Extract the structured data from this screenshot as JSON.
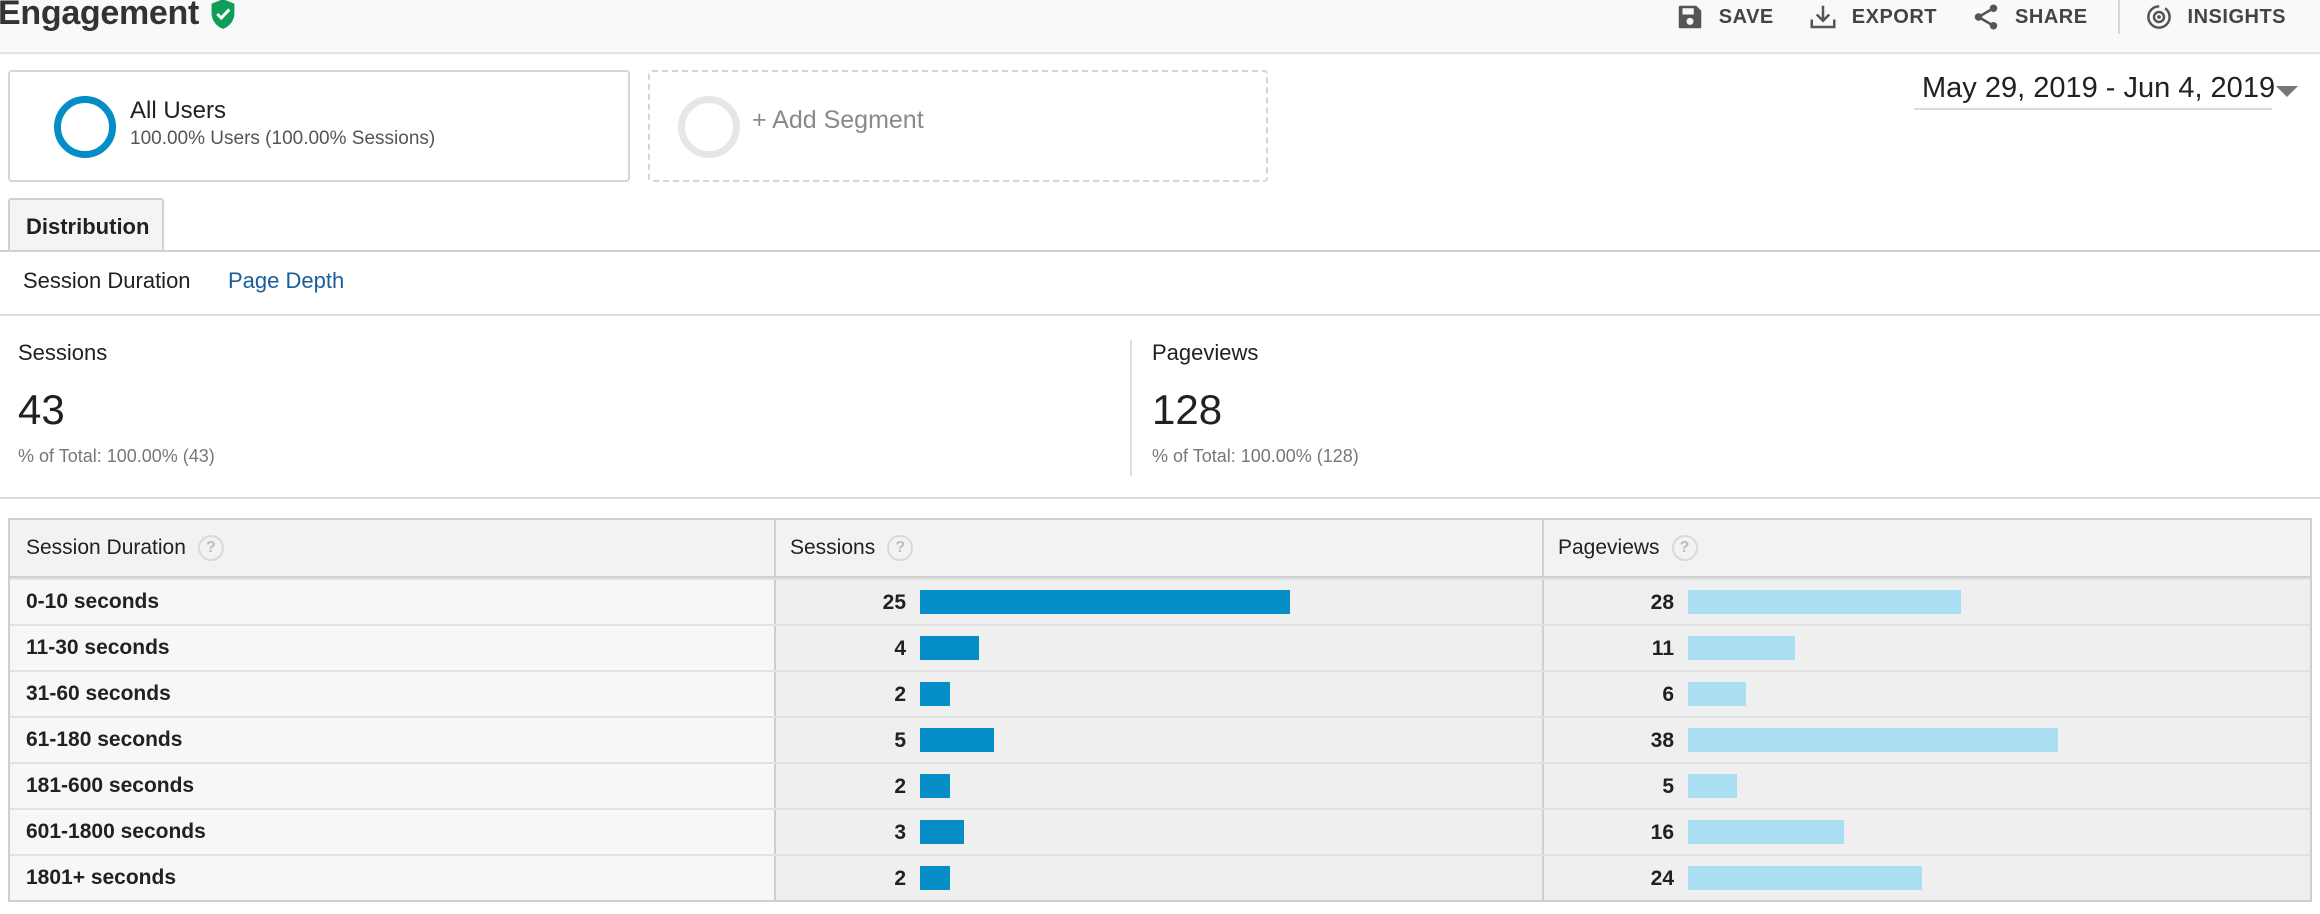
{
  "header": {
    "title": "Engagement",
    "actions": [
      {
        "icon": "save-icon",
        "label": "SAVE"
      },
      {
        "icon": "export-icon",
        "label": "EXPORT"
      },
      {
        "icon": "share-icon",
        "label": "SHARE"
      },
      {
        "icon": "insights-icon",
        "label": "INSIGHTS"
      }
    ]
  },
  "segments": {
    "all": {
      "name": "All Users",
      "detail": "100.00% Users (100.00% Sessions)"
    },
    "add_label": "+ Add Segment"
  },
  "date_range": "May 29, 2019 - Jun 4, 2019",
  "tabs": {
    "main": "Distribution",
    "sub": [
      "Session Duration",
      "Page Depth"
    ]
  },
  "scorecards": [
    {
      "label": "Sessions",
      "value": "43",
      "sub": "% of Total: 100.00% (43)"
    },
    {
      "label": "Pageviews",
      "value": "128",
      "sub": "% of Total: 100.00% (128)"
    }
  ],
  "table": {
    "headers": [
      "Session Duration",
      "Sessions",
      "Pageviews"
    ],
    "help_glyph": "?",
    "rows": [
      {
        "label": "0-10 seconds",
        "sessions": 25,
        "pageviews": 28
      },
      {
        "label": "11-30 seconds",
        "sessions": 4,
        "pageviews": 11
      },
      {
        "label": "31-60 seconds",
        "sessions": 2,
        "pageviews": 6
      },
      {
        "label": "61-180 seconds",
        "sessions": 5,
        "pageviews": 38
      },
      {
        "label": "181-600 seconds",
        "sessions": 2,
        "pageviews": 5
      },
      {
        "label": "601-1800 seconds",
        "sessions": 3,
        "pageviews": 16
      },
      {
        "label": "1801+ seconds",
        "sessions": 2,
        "pageviews": 24
      }
    ]
  },
  "colors": {
    "sessions_bar": "#058dc7",
    "pageviews_bar": "#aadff3",
    "verified": "#0f9d58",
    "link": "#1a5d9c"
  }
}
